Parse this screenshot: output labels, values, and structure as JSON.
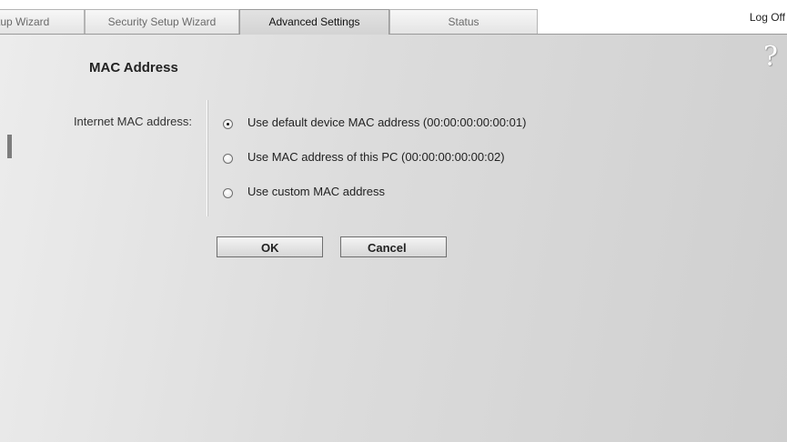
{
  "tabs": {
    "basic_setup": "tup Wizard",
    "security_setup": "Security Setup Wizard",
    "advanced_settings": "Advanced Settings",
    "status": "Status"
  },
  "header": {
    "logoff_label": "Log Off",
    "help_icon": "?"
  },
  "main": {
    "title": "MAC Address",
    "field_label": "Internet MAC address:",
    "options": [
      {
        "label": "Use default device MAC address (00:00:00:00:00:01)",
        "selected": true
      },
      {
        "label": "Use MAC address of this PC (00:00:00:00:00:02)",
        "selected": false
      },
      {
        "label": "Use custom MAC address",
        "selected": false
      }
    ],
    "ok_label": "OK",
    "cancel_label": "Cancel"
  },
  "icons": {
    "help": "question-mark-icon",
    "radio": "radio-button-icon"
  },
  "colors": {
    "panel_light": "#ececec",
    "panel_dark": "#cfcfcf",
    "active_tab": "#d8d8d8",
    "inactive_tab": "#eeeeee"
  }
}
